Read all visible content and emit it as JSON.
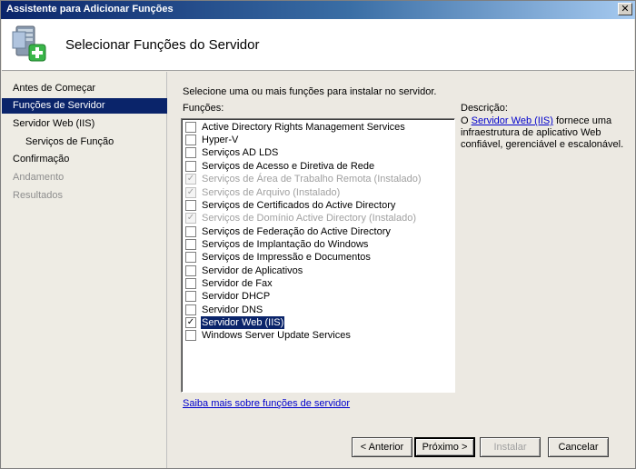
{
  "window": {
    "title": "Assistente para Adicionar Funções",
    "close_glyph": "✕"
  },
  "header": {
    "title": "Selecionar Funções do Servidor",
    "icon": "server-add-icon"
  },
  "nav": {
    "items": [
      {
        "label": "Antes de Começar",
        "state": "normal"
      },
      {
        "label": "Funções de Servidor",
        "state": "selected"
      },
      {
        "label": "Servidor Web (IIS)",
        "state": "normal"
      },
      {
        "label": "Serviços de Função",
        "state": "normal"
      },
      {
        "label": "Confirmação",
        "state": "normal"
      },
      {
        "label": "Andamento",
        "state": "disabled"
      },
      {
        "label": "Resultados",
        "state": "disabled"
      }
    ]
  },
  "main": {
    "intro": "Selecione uma ou mais funções para instalar no servidor.",
    "functions_label": "Funções:",
    "roles": [
      {
        "label": "Active Directory Rights Management Services",
        "checked": false,
        "disabled": false
      },
      {
        "label": "Hyper-V",
        "checked": false,
        "disabled": false
      },
      {
        "label": "Serviços AD LDS",
        "checked": false,
        "disabled": false
      },
      {
        "label": "Serviços de Acesso e Diretiva de Rede",
        "checked": false,
        "disabled": false
      },
      {
        "label": "Serviços de Área de Trabalho Remota  (Instalado)",
        "checked": true,
        "disabled": true
      },
      {
        "label": "Serviços de Arquivo  (Instalado)",
        "checked": true,
        "disabled": true
      },
      {
        "label": "Serviços de Certificados do Active Directory",
        "checked": false,
        "disabled": false
      },
      {
        "label": "Serviços de Domínio Active Directory  (Instalado)",
        "checked": true,
        "disabled": true
      },
      {
        "label": "Serviços de Federação do Active Directory",
        "checked": false,
        "disabled": false
      },
      {
        "label": "Serviços de Implantação do Windows",
        "checked": false,
        "disabled": false
      },
      {
        "label": "Serviços de Impressão e Documentos",
        "checked": false,
        "disabled": false
      },
      {
        "label": "Servidor de Aplicativos",
        "checked": false,
        "disabled": false
      },
      {
        "label": "Servidor de Fax",
        "checked": false,
        "disabled": false
      },
      {
        "label": "Servidor DHCP",
        "checked": false,
        "disabled": false
      },
      {
        "label": "Servidor DNS",
        "checked": false,
        "disabled": false
      },
      {
        "label": "Servidor Web (IIS)",
        "checked": true,
        "disabled": false,
        "selected": true
      },
      {
        "label": "Windows Server Update Services",
        "checked": false,
        "disabled": false
      }
    ],
    "learn_more": "Saiba mais sobre funções de servidor",
    "description": {
      "label": "Descrição:",
      "prefix": "O ",
      "link": "Servidor Web (IIS)",
      "text": " fornece uma infraestrutura de aplicativo Web confiável, gerenciável e escalonável."
    }
  },
  "buttons": {
    "back": "< Anterior",
    "next": "Próximo >",
    "install": "Instalar",
    "cancel": "Cancelar"
  },
  "check_glyph": "✓"
}
